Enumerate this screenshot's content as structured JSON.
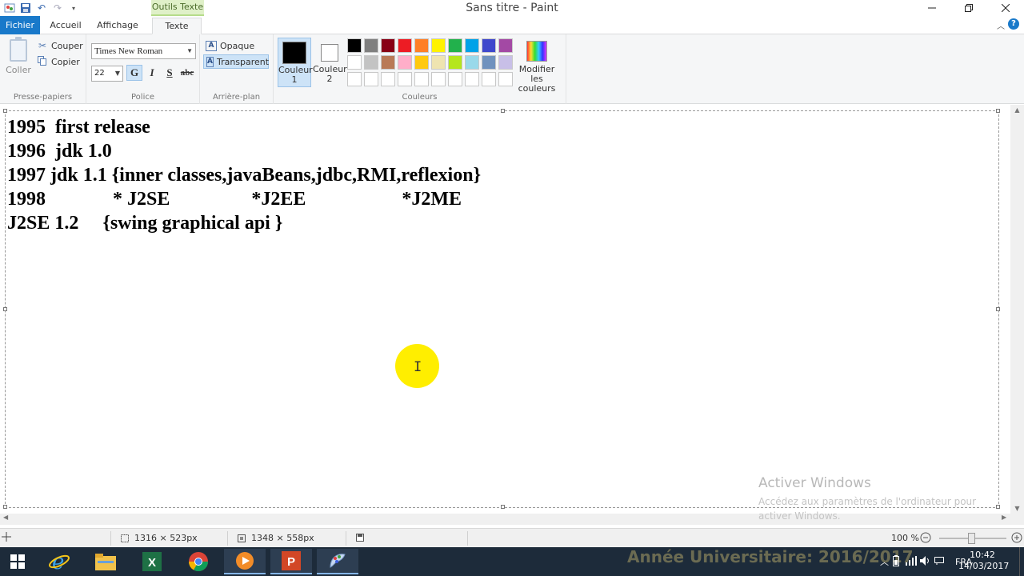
{
  "window": {
    "title": "Sans titre - Paint",
    "contextual_tab_header": "Outils Texte"
  },
  "tabs": {
    "file": "Fichier",
    "home": "Accueil",
    "view": "Affichage",
    "text": "Texte"
  },
  "ribbon": {
    "clipboard": {
      "paste": "Coller",
      "cut": "Couper",
      "copy": "Copier",
      "group_label": "Presse-papiers"
    },
    "font": {
      "family": "Times New Roman",
      "size": "22",
      "bold_label": "G",
      "italic_label": "I",
      "underline_label": "S",
      "strike_label": "abc",
      "group_label": "Police"
    },
    "background": {
      "opaque": "Opaque",
      "transparent": "Transparent",
      "group_label": "Arrière-plan"
    },
    "colors": {
      "color1_label": "Couleur 1",
      "color1_value": "#000000",
      "color2_label": "Couleur 2",
      "color2_value": "#ffffff",
      "edit_colors": "Modifier les couleurs",
      "group_label": "Couleurs",
      "palette_row1": [
        "#000000",
        "#7f7f7f",
        "#880015",
        "#ed1c24",
        "#ff7f27",
        "#fff200",
        "#22b14c",
        "#00a2e8",
        "#3f48cc",
        "#a349a4"
      ],
      "palette_row2": [
        "#ffffff",
        "#c3c3c3",
        "#b97a57",
        "#ffaec9",
        "#ffc90e",
        "#efe4b0",
        "#b5e61d",
        "#99d9ea",
        "#7092be",
        "#c8bfe7"
      ],
      "palette_row3": [
        "#ffffff",
        "#ffffff",
        "#ffffff",
        "#ffffff",
        "#ffffff",
        "#ffffff",
        "#ffffff",
        "#ffffff",
        "#ffffff",
        "#ffffff"
      ]
    }
  },
  "canvas_text": [
    "1995  first release",
    "1996  jdk 1.0",
    "1997 jdk 1.1 {inner classes,javaBeans,jdbc,RMI,reflexion}",
    "1998              * J2SE                 *J2EE                    *J2ME",
    "J2SE 1.2     {swing graphical api }"
  ],
  "activation": {
    "title": "Activer Windows",
    "line1": "Accédez aux paramètres de l'ordinateur pour",
    "line2": "activer Windows."
  },
  "statusbar": {
    "selection_size": "1316 × 523px",
    "image_size": "1348 × 558px",
    "zoom": "100 %"
  },
  "taskbar": {
    "overlay_text": "Année Universitaire: 2016/2017",
    "language": "FRA",
    "time": "10:42",
    "date": "14/03/2017"
  }
}
